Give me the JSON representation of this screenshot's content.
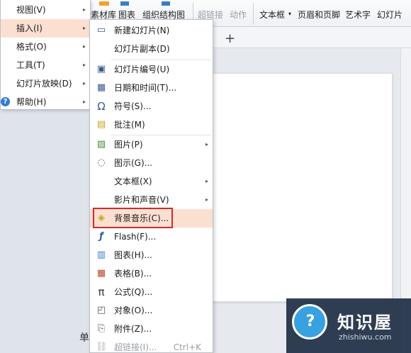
{
  "ribbon": {
    "buttons": [
      "素材库",
      "图表",
      "组织结构图",
      "超链接",
      "动作",
      "文本框",
      "页眉和页脚",
      "艺术字",
      "幻灯片"
    ]
  },
  "main_menu": {
    "items": [
      {
        "label": "视图(V)"
      },
      {
        "label": "插入(I)"
      },
      {
        "label": "格式(O)"
      },
      {
        "label": "工具(T)"
      },
      {
        "label": "幻灯片放映(D)"
      },
      {
        "label": "帮助(H)"
      }
    ]
  },
  "submenu": {
    "items": [
      {
        "label": "新建幻灯片(N)"
      },
      {
        "label": "幻灯片副本(D)"
      },
      {
        "label": "幻灯片编号(U)"
      },
      {
        "label": "日期和时间(T)..."
      },
      {
        "label": "符号(S)..."
      },
      {
        "label": "批注(M)"
      },
      {
        "label": "图片(P)"
      },
      {
        "label": "图示(G)..."
      },
      {
        "label": "文本框(X)"
      },
      {
        "label": "影片和声音(V)"
      },
      {
        "label": "背景音乐(C)..."
      },
      {
        "label": "Flash(F)..."
      },
      {
        "label": "图表(H)..."
      },
      {
        "label": "表格(B)..."
      },
      {
        "label": "公式(Q)..."
      },
      {
        "label": "对象(O)..."
      },
      {
        "label": "附件(Z)..."
      },
      {
        "label": "超链接(I)...",
        "shortcut": "Ctrl+K"
      }
    ]
  },
  "status_fragment": "单",
  "watermark": {
    "title": "知识屋",
    "subtitle": "zhishiwu.com"
  },
  "colors": {
    "highlight": "#fbe0d1",
    "callout_border": "#d22b2b",
    "accent_blue": "#2a9be0"
  }
}
